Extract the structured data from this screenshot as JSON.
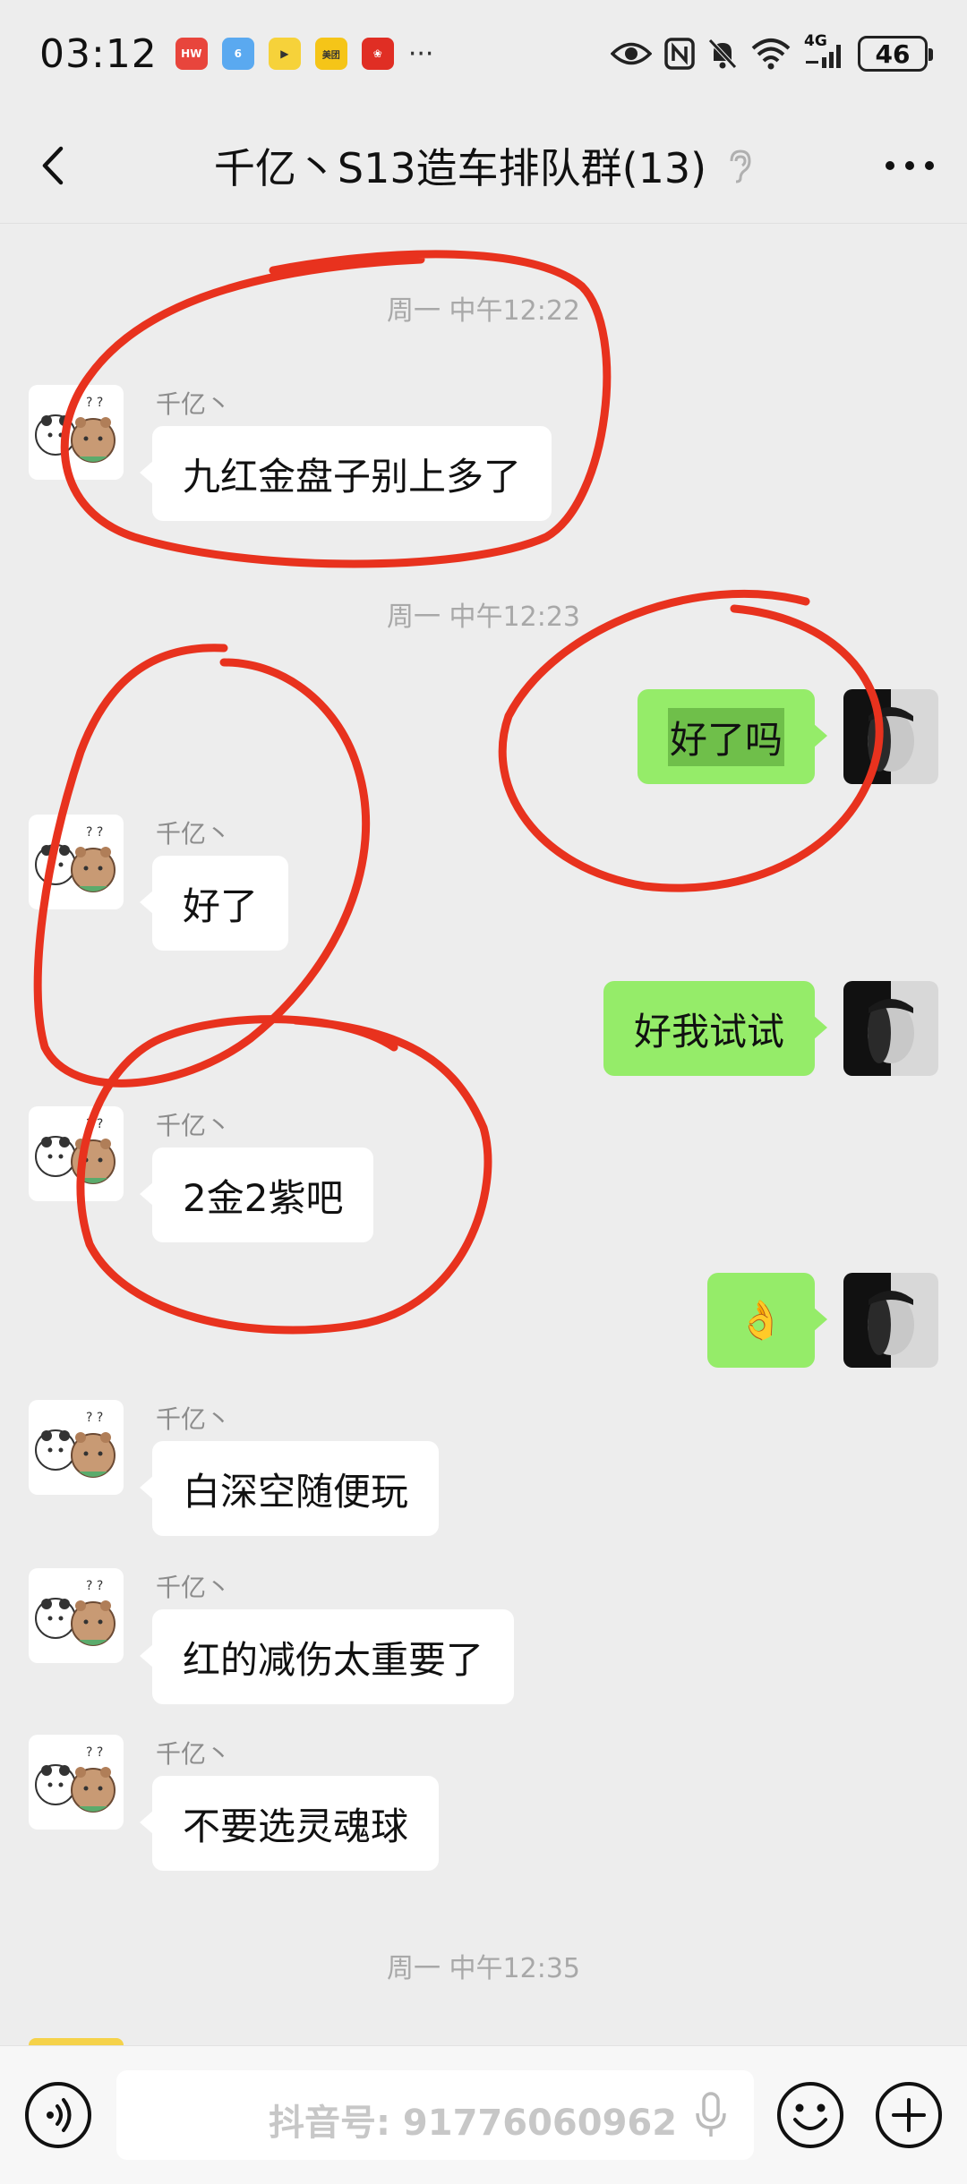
{
  "status_bar": {
    "time": "03:12",
    "ellipsis": "···",
    "battery": "46",
    "network": "4G",
    "notif_icons": [
      "huawei-app-icon",
      "tiktok-icon",
      "video-app-icon",
      "meituan-icon",
      "pinduoduo-icon"
    ]
  },
  "header": {
    "title": "千亿丶S13造车排队群(13)"
  },
  "messages": [
    {
      "type": "time",
      "text": "周一 中午12:22"
    },
    {
      "type": "in",
      "sender": "千亿丶",
      "text": "九红金盘子别上多了"
    },
    {
      "type": "time",
      "text": "周一 中午12:23"
    },
    {
      "type": "out",
      "text": "好了吗"
    },
    {
      "type": "in",
      "sender": "千亿丶",
      "text": "好了"
    },
    {
      "type": "out",
      "text": "好我试试"
    },
    {
      "type": "in",
      "sender": "千亿丶",
      "text": "2金2紫吧"
    },
    {
      "type": "out",
      "text": "👌"
    },
    {
      "type": "in",
      "sender": "千亿丶",
      "text": "白深空随便玩"
    },
    {
      "type": "in",
      "sender": "千亿丶",
      "text": "红的减伤太重要了"
    },
    {
      "type": "in",
      "sender": "千亿丶",
      "text": "不要选灵魂球"
    },
    {
      "type": "time",
      "text": "周一 中午12:35"
    }
  ],
  "input_bar": {
    "watermark": "抖音号: 91776060962"
  },
  "colors": {
    "background": "#ededed",
    "out_bubble": "#95ec69",
    "in_bubble": "#ffffff",
    "annotation": "#e8321e"
  }
}
